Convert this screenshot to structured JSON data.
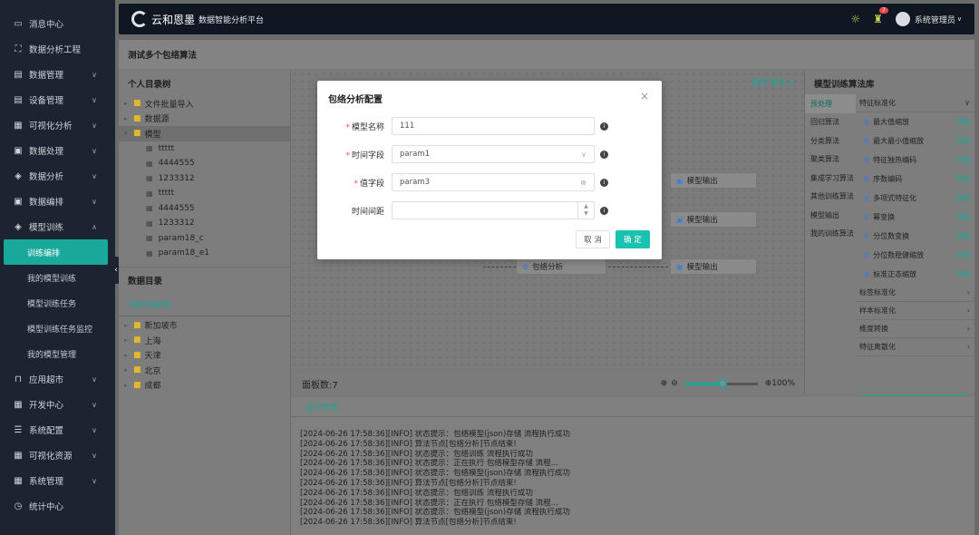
{
  "sidebar": {
    "items": [
      {
        "icon": "message-icon",
        "glyph": "▭",
        "label": "消息中心",
        "chevron": false
      },
      {
        "icon": "workspace-icon",
        "glyph": "⛶",
        "label": "数据分析工程",
        "chevron": false
      },
      {
        "icon": "data-mgmt-icon",
        "glyph": "▤",
        "label": "数据管理",
        "chevron": true
      },
      {
        "icon": "device-icon",
        "glyph": "▤",
        "label": "设备管理",
        "chevron": true
      },
      {
        "icon": "visual-icon",
        "glyph": "▦",
        "label": "可视化分析",
        "chevron": true
      },
      {
        "icon": "process-icon",
        "glyph": "▣",
        "label": "数据处理",
        "chevron": true
      },
      {
        "icon": "analysis-icon",
        "glyph": "◈",
        "label": "数据分析",
        "chevron": true
      },
      {
        "icon": "orchestrate-icon",
        "glyph": "▣",
        "label": "数据编排",
        "chevron": true
      },
      {
        "icon": "model-train-icon",
        "glyph": "◈",
        "label": "模型训练",
        "chevron": true,
        "open": true
      }
    ],
    "subitems": [
      "训练编排",
      "我的模型训练",
      "模型训练任务",
      "模型训练任务监控",
      "我的模型管理"
    ],
    "items2": [
      {
        "icon": "app-market-icon",
        "glyph": "⊓",
        "label": "应用超市",
        "chevron": true
      },
      {
        "icon": "dev-center-icon",
        "glyph": "▦",
        "label": "开发中心",
        "chevron": true
      },
      {
        "icon": "sys-config-icon",
        "glyph": "☰",
        "label": "系统配置",
        "chevron": true
      },
      {
        "icon": "visual-res-icon",
        "glyph": "▦",
        "label": "可视化资源",
        "chevron": true
      },
      {
        "icon": "sys-mgmt-icon",
        "glyph": "▦",
        "label": "系统管理",
        "chevron": true
      },
      {
        "icon": "stats-icon",
        "glyph": "◷",
        "label": "统计中心",
        "chevron": false
      }
    ]
  },
  "header": {
    "logo_text": "云和恩墨",
    "platform": "数据智能分析平台",
    "badge": "7",
    "user": "系统管理员"
  },
  "page": {
    "title": "测试多个包络算法"
  },
  "left": {
    "personal_title": "个人目录树",
    "tree": [
      {
        "type": "folder",
        "label": "文件批量导入",
        "level": 0
      },
      {
        "type": "folder",
        "label": "数据源",
        "level": 0
      },
      {
        "type": "folder",
        "label": "模型",
        "level": 0,
        "open": true,
        "selected": true
      },
      {
        "type": "file",
        "label": "ttttt",
        "level": 1
      },
      {
        "type": "file",
        "label": "4444555",
        "level": 1
      },
      {
        "type": "file",
        "label": "1233312",
        "level": 1
      },
      {
        "type": "file",
        "label": "ttttt",
        "level": 1
      },
      {
        "type": "file",
        "label": "4444555",
        "level": 1
      },
      {
        "type": "file",
        "label": "1233312",
        "level": 1
      },
      {
        "type": "file",
        "label": "param18_c",
        "level": 1
      },
      {
        "type": "file",
        "label": "param18_e1",
        "level": 1
      }
    ],
    "data_title": "数据目录",
    "data_tab": "指标目录树",
    "data_tree": [
      "新加坡市",
      "上海",
      "天津",
      "北京",
      "成都"
    ]
  },
  "canvas": {
    "actions": "调试  更多 ∨",
    "nodes": [
      {
        "label": "模型输出"
      },
      {
        "label": "模型输出"
      },
      {
        "label": "包络分析"
      },
      {
        "label": "模型输出"
      }
    ],
    "panel_count": "面板数:7",
    "zoom": "100%"
  },
  "logs": {
    "tab": "运行信息",
    "lines": [
      "[2024-06-26 17:58:36][INFO] 状态提示：包络模型(json)存储 流程执行成功",
      "[2024-06-26 17:58:36][INFO] 算法节点[包络分析]节点结束!",
      "[2024-06-26 17:58:36][INFO] 状态提示：包络训练 流程执行成功",
      "[2024-06-26 17:58:36][INFO] 状态提示：正在执行 包络模型存储 流程...",
      "[2024-06-26 17:58:36][INFO] 状态提示：包络模型(json)存储 流程执行成功",
      "[2024-06-26 17:58:36][INFO] 算法节点[包络分析]节点结束!",
      "[2024-06-26 17:58:36][INFO] 状态提示：包络训练 流程执行成功",
      "[2024-06-26 17:58:36][INFO] 状态提示：正在执行 包络模型存储 流程...",
      "[2024-06-26 17:58:36][INFO] 状态提示：包络模型(json)存储 流程执行成功",
      "[2024-06-26 17:58:36][INFO] 算法节点[包络分析]节点结束!"
    ]
  },
  "algo": {
    "title": "模型训练算法库",
    "categories": [
      "预处理",
      "回归算法",
      "分类算法",
      "聚类算法",
      "集成学习算法",
      "其他训练算法",
      "模型输出",
      "我的训练算法"
    ],
    "group_open": "特征标准化",
    "items": [
      "最大值缩放",
      "最大最小值缩放",
      "特征独热编码",
      "序数编码",
      "多项式特征化",
      "幂变换",
      "分位数变换",
      "分位数稳健缩放",
      "标准正态缩放"
    ],
    "detail": "详情",
    "groups": [
      "标签标准化",
      "样本标准化",
      "维度转换",
      "特征离散化"
    ]
  },
  "modal": {
    "title": "包络分析配置",
    "fields": [
      {
        "label": "模型名称",
        "required": true,
        "value": "111"
      },
      {
        "label": "时间字段",
        "required": true,
        "value": "param1"
      },
      {
        "label": "值字段",
        "required": true,
        "value": "param3"
      },
      {
        "label": "时间间距",
        "required": false,
        "value": ""
      }
    ],
    "cancel": "取 消",
    "ok": "确 定"
  }
}
